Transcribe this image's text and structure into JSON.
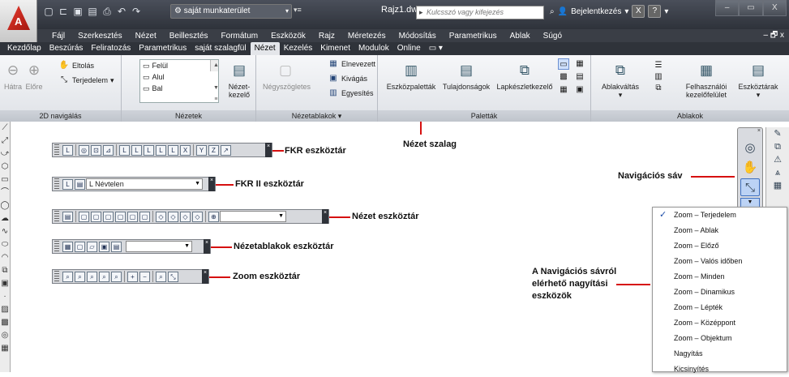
{
  "app": {
    "logo_letter": "A"
  },
  "qat": {
    "icons": [
      "new-icon",
      "open-icon",
      "save-icon",
      "saveas-icon",
      "print-icon",
      "undo-icon",
      "redo-icon"
    ],
    "workspace": "saját munkaterület"
  },
  "title": {
    "filename": "Rajz1.dwg",
    "search_placeholder": "Kulcsszó vagy kifejezés",
    "signin": "Bejelentkezés",
    "help": "?"
  },
  "window": {
    "min": "–",
    "restore": "▭",
    "close": "X"
  },
  "menubar": [
    "Fájl",
    "Szerkesztés",
    "Nézet",
    "Beillesztés",
    "Formátum",
    "Eszközök",
    "Rajz",
    "Méretezés",
    "Módosítás",
    "Parametrikus",
    "Ablak",
    "Súgó"
  ],
  "menubar_right": "– 🗗 x",
  "tabs": [
    "Kezdőlap",
    "Beszúrás",
    "Feliratozás",
    "Parametrikus",
    "saját szalagfül",
    "Nézet",
    "Kezelés",
    "Kimenet",
    "Modulok",
    "Online",
    "▭ ▾"
  ],
  "active_tab": "Nézet",
  "ribbon": {
    "nav2d": {
      "title": "2D navigálás",
      "back": "Hátra",
      "forward": "Előre",
      "pan": "Eltolás",
      "zoom": "Terjedelem"
    },
    "views": {
      "title": "Nézetek",
      "items": [
        "Felül",
        "Alul",
        "Bal"
      ],
      "manager_line1": "Nézet-",
      "manager_line2": "kezelő"
    },
    "viewports": {
      "title": "Nézetablakok ▾",
      "named": "Négyszögletes",
      "b1": "Elnevezett",
      "b2": "Kivágás",
      "b3": "Egyesítés"
    },
    "palettes": {
      "title": "Paletták",
      "tool": "Eszközpaletták",
      "props": "Tulajdonságok",
      "layer": "Lapkészletkezelő"
    },
    "windows": {
      "title": "Ablakok",
      "switch": "Ablakváltás",
      "ui_line1": "Felhasználói",
      "ui_line2": "kezelőfelület",
      "toolbars": "Eszköztárak"
    }
  },
  "canvas_labels": {
    "ribbon": "Nézet szalag",
    "fkr": "FKR eszköztár",
    "fkr2": "FKR II eszköztár",
    "fkr2_combo": "Névtelen",
    "view": "Nézet eszköztár",
    "vports": "Nézetablakok eszköztár",
    "zoom": "Zoom eszköztár",
    "navbar": "Navigációs sáv",
    "navnote_1": "A Navigációs sávról",
    "navnote_2": "elérhető nagyítási",
    "navnote_3": "eszközök"
  },
  "zoom_menu": [
    "Zoom – Terjedelem",
    "Zoom – Ablak",
    "Zoom – Előző",
    "Zoom – Valós időben",
    "Zoom – Minden",
    "Zoom – Dinamikus",
    "Zoom – Lépték",
    "Zoom – Középpont",
    "Zoom – Objektum",
    "Nagyítás",
    "Kicsinyítés"
  ],
  "zoom_checked": "✓"
}
